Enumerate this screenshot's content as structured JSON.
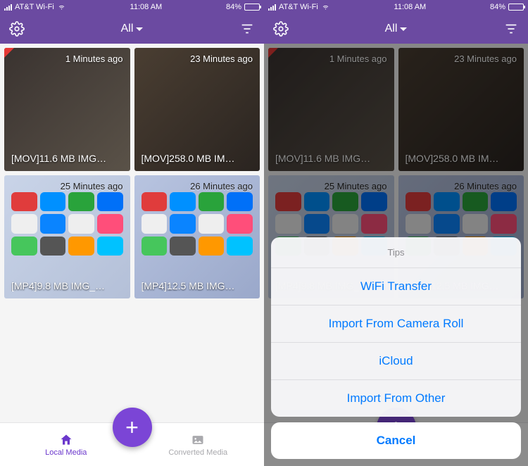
{
  "status": {
    "carrier": "AT&T Wi-Fi",
    "time": "11:08 AM",
    "battery_text": "84%"
  },
  "header": {
    "title": "All"
  },
  "media": [
    {
      "time": "1 Minutes ago",
      "label": "[MOV]11.6 MB IMG…"
    },
    {
      "time": "23 Minutes ago",
      "label": "[MOV]258.0 MB IM…"
    },
    {
      "time": "25 Minutes ago",
      "label": "[MP4]9.8 MB IMG_…"
    },
    {
      "time": "26 Minutes ago",
      "label": "[MP4]12.5 MB IMG…"
    }
  ],
  "tabs": {
    "local": "Local Media",
    "converted": "Converted Media"
  },
  "sheet": {
    "title": "Tips",
    "options": [
      "WiFi Transfer",
      "Import From Camera Roll",
      "iCloud",
      "Import From Other"
    ],
    "cancel": "Cancel"
  }
}
